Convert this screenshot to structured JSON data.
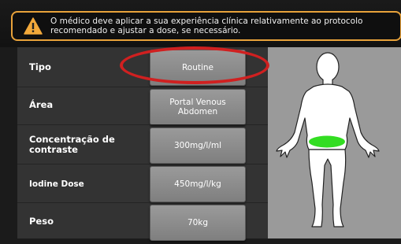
{
  "banner": {
    "message": "O médico deve aplicar a sua experiência clínica relativamente ao protocolo recomendado e ajustar a dose, se necessário."
  },
  "form": {
    "rows": [
      {
        "label": "Tipo",
        "value_line1": "Routine",
        "value_line2": ""
      },
      {
        "label": "Área",
        "value_line1": "Portal Venous",
        "value_line2": "Abdomen"
      },
      {
        "label": "Concentração de contraste",
        "value_line1": "300mg/l/ml",
        "value_line2": ""
      },
      {
        "label": "Iodine Dose",
        "value_line1": "450mg/l/kg",
        "value_line2": ""
      },
      {
        "label": "Peso",
        "value_line1": "70kg",
        "value_line2": ""
      }
    ]
  },
  "body_map": {
    "highlight_color": "#33dd22",
    "highlight_region": "abdomen"
  },
  "colors": {
    "warning_border": "#e8a23a",
    "annotation_ring": "#d02020"
  }
}
